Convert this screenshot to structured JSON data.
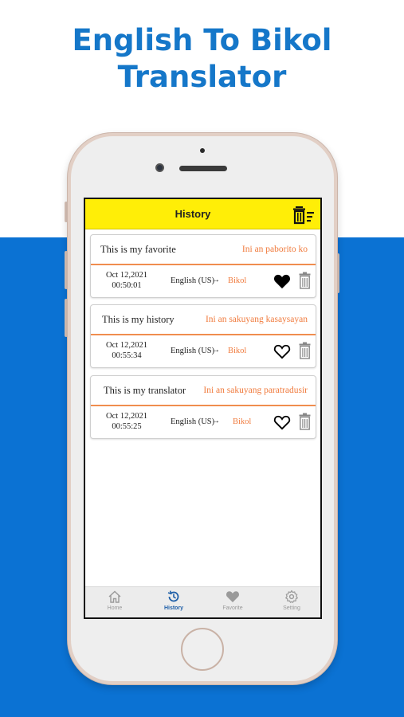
{
  "headline": {
    "line1": "English To Bikol",
    "line2": "Translator"
  },
  "colors": {
    "accent_blue": "#0b72d3",
    "appbar_yellow": "#ffee07",
    "target_orange": "#f07a3c",
    "tab_active": "#1f5fa8"
  },
  "appbar": {
    "title": "History",
    "clear_icon": "clear-all-icon"
  },
  "history": [
    {
      "source": "This is my favorite",
      "target": "Ini an paborito ko",
      "date": "Oct 12,2021",
      "time": "00:50:01",
      "from_lang": "English (US)",
      "arrow": "→",
      "to_lang": "Bikol",
      "favorited": true
    },
    {
      "source": "This is my history",
      "target": "Ini an sakuyang kasaysayan",
      "date": "Oct 12,2021",
      "time": "00:55:34",
      "from_lang": "English (US)",
      "arrow": "→",
      "to_lang": "Bikol",
      "favorited": false
    },
    {
      "source": "This is my translator",
      "target": "Ini an sakuyang paratradusir",
      "date": "Oct 12,2021",
      "time": "00:55:25",
      "from_lang": "English (US)",
      "arrow": "→",
      "to_lang": "Bikol",
      "favorited": false
    }
  ],
  "tabs": [
    {
      "label": "Home",
      "icon": "home-icon",
      "active": false
    },
    {
      "label": "History",
      "icon": "history-icon",
      "active": true
    },
    {
      "label": "Favorite",
      "icon": "heart-icon",
      "active": false
    },
    {
      "label": "Setting",
      "icon": "gear-icon",
      "active": false
    }
  ]
}
